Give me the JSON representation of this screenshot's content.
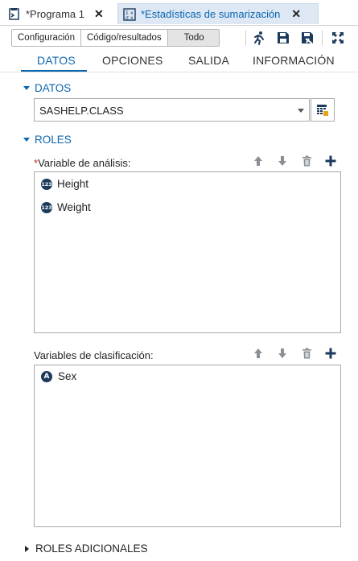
{
  "doc_tabs": [
    {
      "label": "*Programa 1",
      "icon": "program-icon",
      "active": false
    },
    {
      "label": "*Estadísticas de sumarización",
      "icon": "stats-task-icon",
      "active": true
    }
  ],
  "toolbar": {
    "view_modes": [
      "Configuración",
      "Código/resultados",
      "Todo"
    ],
    "selected_view": "Todo",
    "icons": [
      "run-icon",
      "save-icon",
      "save-as-icon",
      "maximize-icon"
    ]
  },
  "section_tabs": [
    "DATOS",
    "OPCIONES",
    "SALIDA",
    "INFORMACIÓN"
  ],
  "active_section_tab": "DATOS",
  "data_section": {
    "title": "DATOS",
    "dataset": "SASHELP.CLASS"
  },
  "roles_section": {
    "title": "ROLES",
    "analysis": {
      "required_marker": "*",
      "label": "Variable de análisis:",
      "items": [
        {
          "name": "Height",
          "type_icon": "123"
        },
        {
          "name": "Weight",
          "type_icon": "123"
        }
      ]
    },
    "classification": {
      "label": "Variables de clasificación:",
      "items": [
        {
          "name": "Sex",
          "type_icon": "A"
        }
      ]
    }
  },
  "additional_roles": {
    "title": "ROLES ADICIONALES"
  },
  "colors": {
    "accent": "#0a66b0",
    "required": "#d4202a",
    "icon_dark": "#1b3a5c"
  }
}
